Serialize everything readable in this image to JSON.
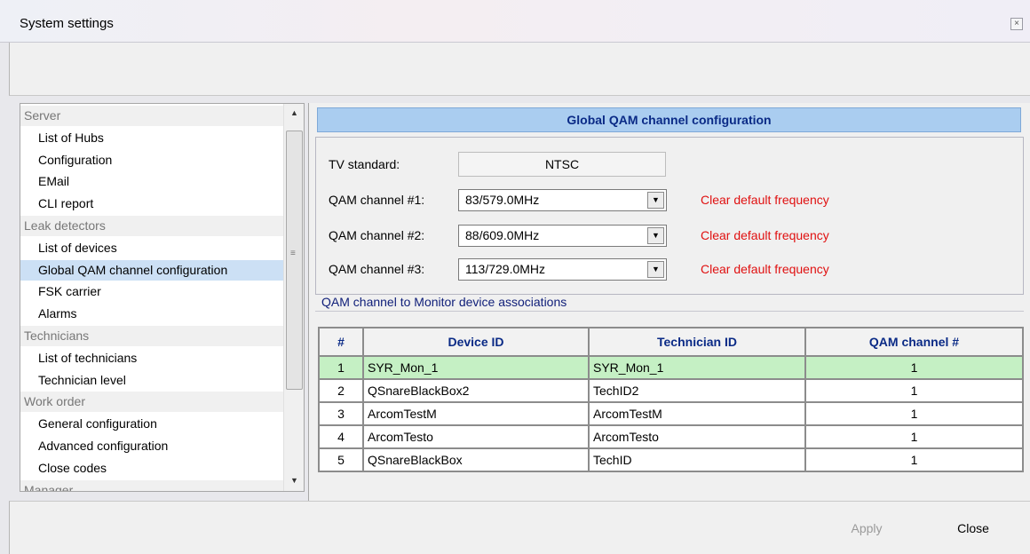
{
  "window": {
    "title": "System settings",
    "close_icon": "×"
  },
  "sidebar": {
    "scroll_up": "▲",
    "scroll_down": "▼",
    "grip": "≡",
    "items": [
      {
        "label": "Server",
        "type": "group"
      },
      {
        "label": "List of Hubs",
        "type": "leaf"
      },
      {
        "label": "Configuration",
        "type": "leaf"
      },
      {
        "label": "EMail",
        "type": "leaf"
      },
      {
        "label": "CLI report",
        "type": "leaf"
      },
      {
        "label": "Leak detectors",
        "type": "group"
      },
      {
        "label": "List of devices",
        "type": "leaf"
      },
      {
        "label": "Global QAM channel configuration",
        "type": "leaf",
        "selected": true
      },
      {
        "label": "FSK carrier",
        "type": "leaf"
      },
      {
        "label": "Alarms",
        "type": "leaf"
      },
      {
        "label": "Technicians",
        "type": "group"
      },
      {
        "label": "List of technicians",
        "type": "leaf"
      },
      {
        "label": "Technician level",
        "type": "leaf"
      },
      {
        "label": "Work order",
        "type": "group"
      },
      {
        "label": "General configuration",
        "type": "leaf"
      },
      {
        "label": "Advanced configuration",
        "type": "leaf"
      },
      {
        "label": "Close codes",
        "type": "leaf"
      },
      {
        "label": "Manager",
        "type": "group"
      }
    ]
  },
  "main": {
    "header": "Global QAM channel configuration",
    "tv_standard_label": "TV standard:",
    "tv_standard_value": "NTSC",
    "channels": [
      {
        "label": "QAM channel #1:",
        "value": "83/579.0MHz",
        "clear": "Clear default frequency"
      },
      {
        "label": "QAM channel #2:",
        "value": "88/609.0MHz",
        "clear": "Clear default frequency"
      },
      {
        "label": "QAM channel #3:",
        "value": "113/729.0MHz",
        "clear": "Clear default frequency"
      }
    ],
    "dropdown_arrow": "▼",
    "assoc_label": "QAM channel to Monitor device associations",
    "table": {
      "headers": [
        "#",
        "Device ID",
        "Technician ID",
        "QAM channel #"
      ],
      "rows": [
        {
          "n": "1",
          "device": "SYR_Mon_1",
          "tech": "SYR_Mon_1",
          "qam": "1"
        },
        {
          "n": "2",
          "device": "QSnareBlackBox2",
          "tech": "TechID2",
          "qam": "1"
        },
        {
          "n": "3",
          "device": "ArcomTestM",
          "tech": "ArcomTestM",
          "qam": "1"
        },
        {
          "n": "4",
          "device": "ArcomTesto",
          "tech": "ArcomTesto",
          "qam": "1"
        },
        {
          "n": "5",
          "device": "QSnareBlackBox",
          "tech": "TechID",
          "qam": "1"
        }
      ],
      "selected_row": 0
    }
  },
  "footer": {
    "apply_label": "Apply",
    "close_label": "Close"
  }
}
